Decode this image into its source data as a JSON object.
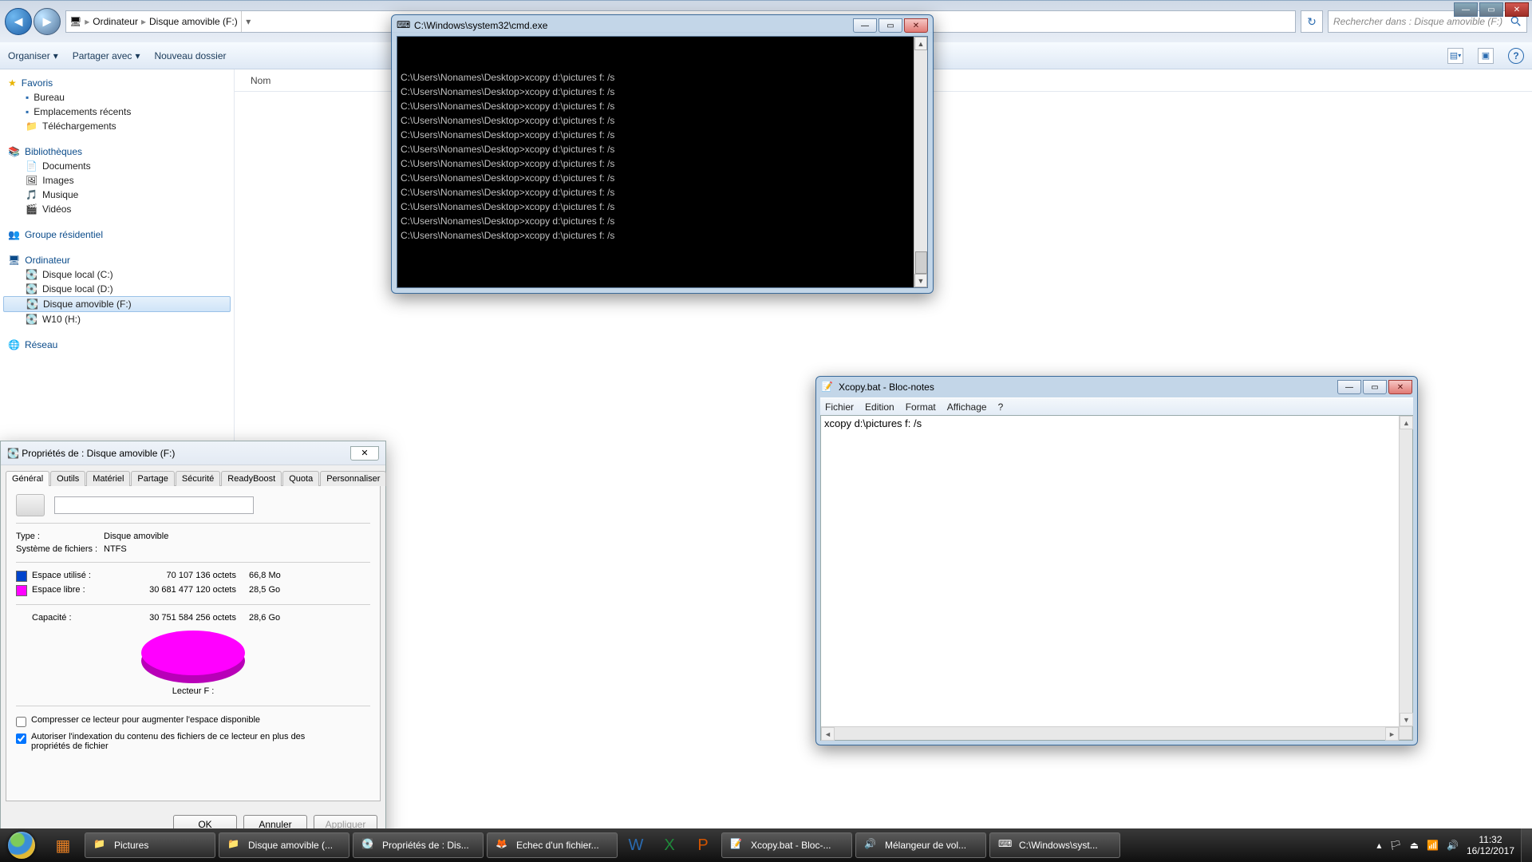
{
  "explorer": {
    "breadcrumb": {
      "computer": "Ordinateur",
      "drive": "Disque amovible (F:)"
    },
    "search_placeholder": "Rechercher dans : Disque amovible (F:)",
    "toolbar": {
      "organize": "Organiser",
      "share": "Partager avec",
      "newfolder": "Nouveau dossier"
    },
    "content_header": "Nom",
    "nav": {
      "favorites": {
        "title": "Favoris",
        "items": [
          "Bureau",
          "Emplacements récents",
          "Téléchargements"
        ]
      },
      "libraries": {
        "title": "Bibliothèques",
        "items": [
          "Documents",
          "Images",
          "Musique",
          "Vidéos"
        ]
      },
      "homegroup": "Groupe résidentiel",
      "computer": {
        "title": "Ordinateur",
        "items": [
          "Disque local (C:)",
          "Disque local (D:)",
          "Disque amovible (F:)",
          "W10 (H:)"
        ],
        "selected_index": 2
      },
      "network": "Réseau"
    }
  },
  "cmd": {
    "title": "C:\\Windows\\system32\\cmd.exe",
    "line": "C:\\Users\\Nonames\\Desktop>xcopy d:\\pictures f: /s",
    "repeat": 12
  },
  "notepad": {
    "title": "Xcopy.bat - Bloc-notes",
    "menu": [
      "Fichier",
      "Edition",
      "Format",
      "Affichage",
      "?"
    ],
    "content": "xcopy d:\\pictures f: /s"
  },
  "props": {
    "title": "Propriétés de : Disque amovible (F:)",
    "tabs": [
      "Général",
      "Outils",
      "Matériel",
      "Partage",
      "Sécurité",
      "ReadyBoost",
      "Quota",
      "Personnaliser"
    ],
    "active_tab": 0,
    "type_k": "Type :",
    "type_v": "Disque amovible",
    "fs_k": "Système de fichiers :",
    "fs_v": "NTFS",
    "used_k": "Espace utilisé :",
    "used_bytes": "70 107 136 octets",
    "used_h": "66,8 Mo",
    "free_k": "Espace libre :",
    "free_bytes": "30 681 477 120 octets",
    "free_h": "28,5 Go",
    "cap_k": "Capacité :",
    "cap_bytes": "30 751 584 256 octets",
    "cap_h": "28,6 Go",
    "drive_label": "Lecteur F :",
    "chk_compress": "Compresser ce lecteur pour augmenter l'espace disponible",
    "chk_index": "Autoriser l'indexation du contenu des fichiers de ce lecteur en plus des propriétés de fichier",
    "btn_ok": "OK",
    "btn_cancel": "Annuler",
    "btn_apply": "Appliquer"
  },
  "taskbar": {
    "items": [
      "Pictures",
      "Disque amovible (...",
      "Propriétés de : Dis...",
      "Echec d'un fichier...",
      "Xcopy.bat - Bloc-...",
      "Mélangeur de vol...",
      "C:\\Windows\\syst..."
    ],
    "time": "11:32",
    "date": "16/12/2017"
  },
  "chart_data": {
    "type": "pie",
    "title": "Lecteur F :",
    "series": [
      {
        "name": "Espace utilisé",
        "bytes": 70107136,
        "human": "66,8 Mo",
        "color": "#0044cc"
      },
      {
        "name": "Espace libre",
        "bytes": 30681477120,
        "human": "28,5 Go",
        "color": "#ff00ff"
      }
    ],
    "total": {
      "name": "Capacité",
      "bytes": 30751584256,
      "human": "28,6 Go"
    }
  }
}
